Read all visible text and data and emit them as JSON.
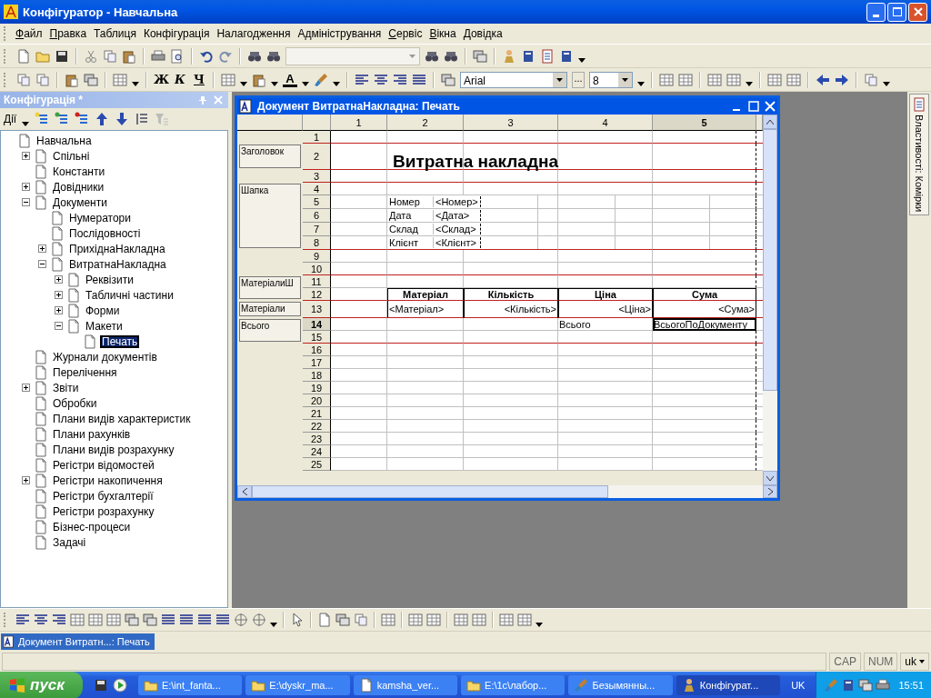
{
  "window": {
    "title": "Конфігуратор - Навчальна"
  },
  "menu": [
    {
      "label": "Файл",
      "mnemonic": true
    },
    {
      "label": "Правка",
      "mnemonic": true
    },
    {
      "label": "Таблиця",
      "mnemonic": false
    },
    {
      "label": "Конфігурація",
      "mnemonic": false
    },
    {
      "label": "Налагодження",
      "mnemonic": false
    },
    {
      "label": "Адміністрування",
      "mnemonic": false
    },
    {
      "label": "Сервіс",
      "mnemonic": true
    },
    {
      "label": "Вікна",
      "mnemonic": true
    },
    {
      "label": "Довідка",
      "mnemonic": true
    }
  ],
  "format_toolbar": {
    "bold": "Ж",
    "italic": "К",
    "underline": "Ч",
    "font_color": "A",
    "font": "Arial",
    "font_more": "...",
    "size": "8"
  },
  "config_panel": {
    "title": "Конфігурація *",
    "actions": "Дії",
    "tree": [
      {
        "label": "Навчальна",
        "selected": false,
        "children": [
          {
            "label": "Спільні",
            "selected": false,
            "expanded": false
          },
          {
            "label": "Константи",
            "selected": false
          },
          {
            "label": "Довідники",
            "selected": false,
            "expanded": false
          },
          {
            "label": "Документи",
            "selected": false,
            "expanded": true,
            "children": [
              {
                "label": "Нумератори",
                "selected": false
              },
              {
                "label": "Послідовності",
                "selected": false
              },
              {
                "label": "ПрихіднаНакладна",
                "selected": false,
                "expanded": false
              },
              {
                "label": "ВитратнаНакладна",
                "selected": false,
                "expanded": true,
                "children": [
                  {
                    "label": "Реквізити",
                    "selected": false,
                    "expanded": false
                  },
                  {
                    "label": "Табличні частини",
                    "selected": false,
                    "expanded": false
                  },
                  {
                    "label": "Форми",
                    "selected": false,
                    "expanded": false
                  },
                  {
                    "label": "Макети",
                    "selected": false,
                    "expanded": true,
                    "children": [
                      {
                        "label": "Печать",
                        "selected": true
                      }
                    ]
                  }
                ]
              }
            ]
          },
          {
            "label": "Журнали документів",
            "selected": false
          },
          {
            "label": "Перелічення",
            "selected": false
          },
          {
            "label": "Звіти",
            "selected": false,
            "expanded": false
          },
          {
            "label": "Обробки",
            "selected": false
          },
          {
            "label": "Плани видів характеристик",
            "selected": false
          },
          {
            "label": "Плани рахунків",
            "selected": false
          },
          {
            "label": "Плани видів розрахунку",
            "selected": false
          },
          {
            "label": "Регістри відомостей",
            "selected": false
          },
          {
            "label": "Регістри накопичення",
            "selected": false,
            "expanded": false
          },
          {
            "label": "Регістри бухгалтерії",
            "selected": false
          },
          {
            "label": "Регістри розрахунку",
            "selected": false
          },
          {
            "label": "Бізнес-процеси",
            "selected": false
          },
          {
            "label": "Задачі",
            "selected": false
          }
        ]
      }
    ]
  },
  "document_window": {
    "title": "Документ ВитратнаНакладна: Печать",
    "sheet": {
      "columns": [
        {
          "label": "1",
          "selected": false
        },
        {
          "label": "2",
          "selected": false
        },
        {
          "label": "3",
          "selected": false
        },
        {
          "label": "4",
          "selected": false
        },
        {
          "label": "5",
          "selected": true
        }
      ],
      "rows": [
        {
          "number": "1",
          "selected": false,
          "area_end": true
        },
        {
          "number": "2",
          "selected": false,
          "area_end": true,
          "band_label": "Заголовок",
          "tall": true,
          "column_2": {
            "text": "Витратна накладна",
            "kind": "title",
            "selected": false
          }
        },
        {
          "number": "3",
          "selected": false,
          "area_end": true
        },
        {
          "number": "4",
          "selected": false,
          "area_end": false,
          "band_label": "Шапка"
        },
        {
          "number": "5",
          "selected": false,
          "area_end": false,
          "in_band": true,
          "column_2": {
            "label": "Номер",
            "value": "<Номер>",
            "kind": "pair",
            "selected": false
          }
        },
        {
          "number": "6",
          "selected": false,
          "area_end": false,
          "in_band": true,
          "column_2": {
            "label": "Дата",
            "value": "<Дата>",
            "kind": "pair",
            "selected": false
          }
        },
        {
          "number": "7",
          "selected": false,
          "area_end": false,
          "in_band": true,
          "column_2": {
            "label": "Склад",
            "value": "<Склад>",
            "kind": "pair",
            "selected": false
          }
        },
        {
          "number": "8",
          "selected": false,
          "area_end": true,
          "in_band": true,
          "column_2": {
            "label": "Клієнт",
            "value": "<Клієнт>",
            "kind": "pair",
            "selected": false
          }
        },
        {
          "number": "9",
          "selected": false,
          "area_end": false
        },
        {
          "number": "10",
          "selected": false,
          "area_end": true
        },
        {
          "number": "11",
          "selected": false,
          "area_end": false,
          "band_label": "МатеріалиШ"
        },
        {
          "number": "12",
          "selected": false,
          "area_end": true,
          "in_band": true,
          "column_2": {
            "text": "Матеріал",
            "kind": "header",
            "selected": false
          },
          "column_3": {
            "text": "Кількість",
            "kind": "header",
            "selected": false
          },
          "column_4": {
            "text": "Ціна",
            "kind": "header",
            "selected": false
          },
          "column_5": {
            "text": "Сума",
            "kind": "header",
            "selected": false
          }
        },
        {
          "number": "13",
          "selected": false,
          "area_end": true,
          "band_label": "Матеріали",
          "column_2": {
            "text": "<Матеріал>",
            "kind": "boxed",
            "selected": false
          },
          "column_3": {
            "text": "<Кількість>",
            "kind": "boxed-right",
            "selected": false
          },
          "column_4": {
            "text": "<Ціна>",
            "kind": "boxed-right",
            "selected": false
          },
          "column_5": {
            "text": "<Сума>",
            "kind": "boxed-right",
            "selected": false
          }
        },
        {
          "number": "14",
          "selected": true,
          "area_end": false,
          "band_label": "Всього",
          "column_4": {
            "text": "Всього",
            "kind": "plain",
            "selected": false
          },
          "column_5": {
            "text": "ВсьогоПоДокументу",
            "kind": "plain",
            "selected": true
          }
        },
        {
          "number": "15",
          "selected": false,
          "area_end": true,
          "in_band": true
        },
        {
          "number": "16",
          "selected": false,
          "area_end": false
        },
        {
          "number": "17",
          "selected": false,
          "area_end": false
        },
        {
          "number": "18",
          "selected": false,
          "area_end": false
        },
        {
          "number": "19",
          "selected": false,
          "area_end": false
        },
        {
          "number": "20",
          "selected": false,
          "area_end": false
        },
        {
          "number": "21",
          "selected": false,
          "area_end": false
        },
        {
          "number": "22",
          "selected": false,
          "area_end": false
        },
        {
          "number": "23",
          "selected": false,
          "area_end": false
        },
        {
          "number": "24",
          "selected": false,
          "area_end": false
        },
        {
          "number": "25",
          "selected": false,
          "area_end": false
        }
      ]
    }
  },
  "properties_tab": {
    "label": "Властивості: Комірки"
  },
  "window_tabs": [
    {
      "label": "Документ Витратн...: Печать",
      "selected": true
    }
  ],
  "status_bar": {
    "cap": "CAP",
    "num": "NUM",
    "language": "uk"
  },
  "taskbar": {
    "start": "пуск",
    "tasks": [
      {
        "label": "E:\\int_fanta...",
        "kind": "folder",
        "selected": false
      },
      {
        "label": "E:\\dyskr_ma...",
        "kind": "folder",
        "selected": false
      },
      {
        "label": "kamsha_ver...",
        "kind": "document",
        "selected": false
      },
      {
        "label": "E:\\1c\\лабор...",
        "kind": "folder",
        "selected": false
      },
      {
        "label": "Безымянны...",
        "kind": "paint",
        "selected": false
      },
      {
        "label": "Конфігурат...",
        "kind": "app",
        "selected": true
      }
    ],
    "language": "UK",
    "clock": "15:51"
  }
}
